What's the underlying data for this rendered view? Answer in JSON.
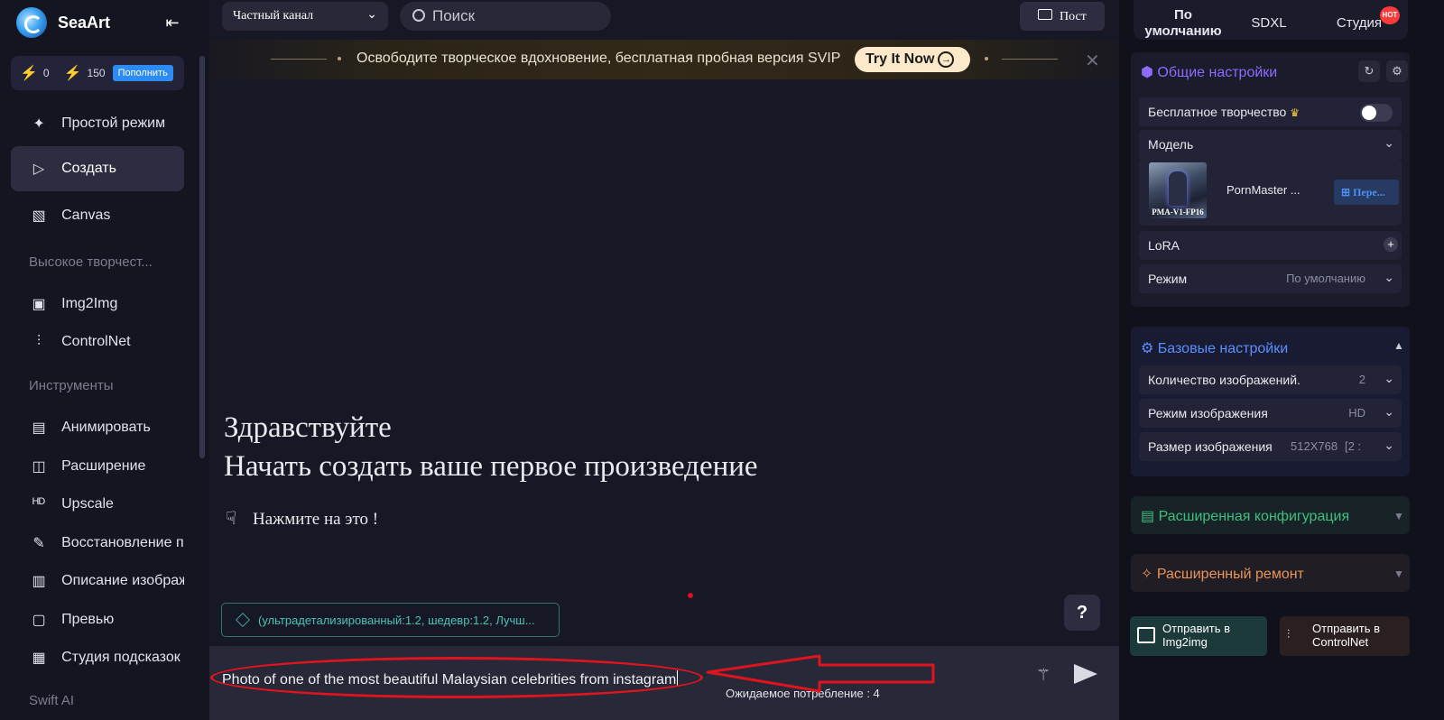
{
  "app": {
    "name": "SeaArt"
  },
  "wallet": {
    "stamina": "0",
    "credits": "150",
    "topup_label": "Пополнить"
  },
  "sidebar": {
    "items": [
      {
        "label": "Простой режим",
        "icon": "sparkle-icon"
      },
      {
        "label": "Создать",
        "icon": "play-icon",
        "active": true
      },
      {
        "label": "Canvas",
        "icon": "canvas-icon"
      }
    ],
    "section_high": "Высокое творчест...",
    "high_items": [
      {
        "label": "Img2Img",
        "icon": "image-icon"
      },
      {
        "label": "ControlNet",
        "icon": "sliders-icon"
      }
    ],
    "section_tools": "Инструменты",
    "tool_items": [
      {
        "label": "Анимировать",
        "icon": "gif-icon"
      },
      {
        "label": "Расширение",
        "icon": "expand-icon"
      },
      {
        "label": "Upscale",
        "icon": "hd-icon"
      },
      {
        "label": "Восстановление пе",
        "icon": "repair-icon"
      },
      {
        "label": "Описание изображ",
        "icon": "book-icon"
      },
      {
        "label": "Превью",
        "icon": "preview-icon"
      },
      {
        "label": "Студия подсказок",
        "icon": "prompt-icon"
      }
    ],
    "section_swift": "Swift AI"
  },
  "topbar": {
    "channel": "Частный канал",
    "search_placeholder": "Поиск",
    "post_label": "Пост"
  },
  "promo": {
    "text": "Освободите творческое вдохновение, бесплатная пробная версия SVIP",
    "cta": "Try It Now"
  },
  "main": {
    "greeting": "Здравствуйте",
    "subtitle": "Начать создать ваше первое произведение",
    "click_hint": "Нажмите на это !",
    "tag_chip": "(ультрадетализированный:1.2, шедевр:1.2, Лучш...",
    "help": "?"
  },
  "prompt": {
    "text": "Photo of one of the most beautiful Malaysian celebrities from instagram",
    "cost": "Ожидаемое потребление : 4"
  },
  "right_panel": {
    "model_tabs": [
      "По умолчанию",
      "SDXL",
      "Студия"
    ],
    "hot_badge": "HOT",
    "general": {
      "title": "Общие настройки",
      "free_creation": "Бесплатное творчество",
      "model_label": "Модель",
      "model_name": "PornMaster ...",
      "model_thumb_caption": "PMA-V1-FP16",
      "switch_label": "Пере...",
      "lora_label": "LoRA",
      "mode_label": "Режим",
      "mode_value": "По умолчанию"
    },
    "basic": {
      "title": "Базовые настройки",
      "count_label": "Количество изображений.",
      "count_value": "2",
      "image_mode_label": "Режим изображения",
      "image_mode_value": "HD",
      "size_label": "Размер изображения",
      "size_value": "512X768",
      "size_ratio": "[2 :"
    },
    "advanced_config": "Расширенная конфигурация",
    "advanced_repair": "Расширенный ремонт",
    "send_img2img": "Отправить в Img2img",
    "send_controlnet": "Отправить в ControlNet"
  },
  "colors": {
    "accent_blue": "#2c8cf4",
    "advanced_green": "#3fbf7f",
    "repair_orange": "#e8945a",
    "annotation_red": "#e0141e",
    "general_purple": "#8b6cff"
  }
}
